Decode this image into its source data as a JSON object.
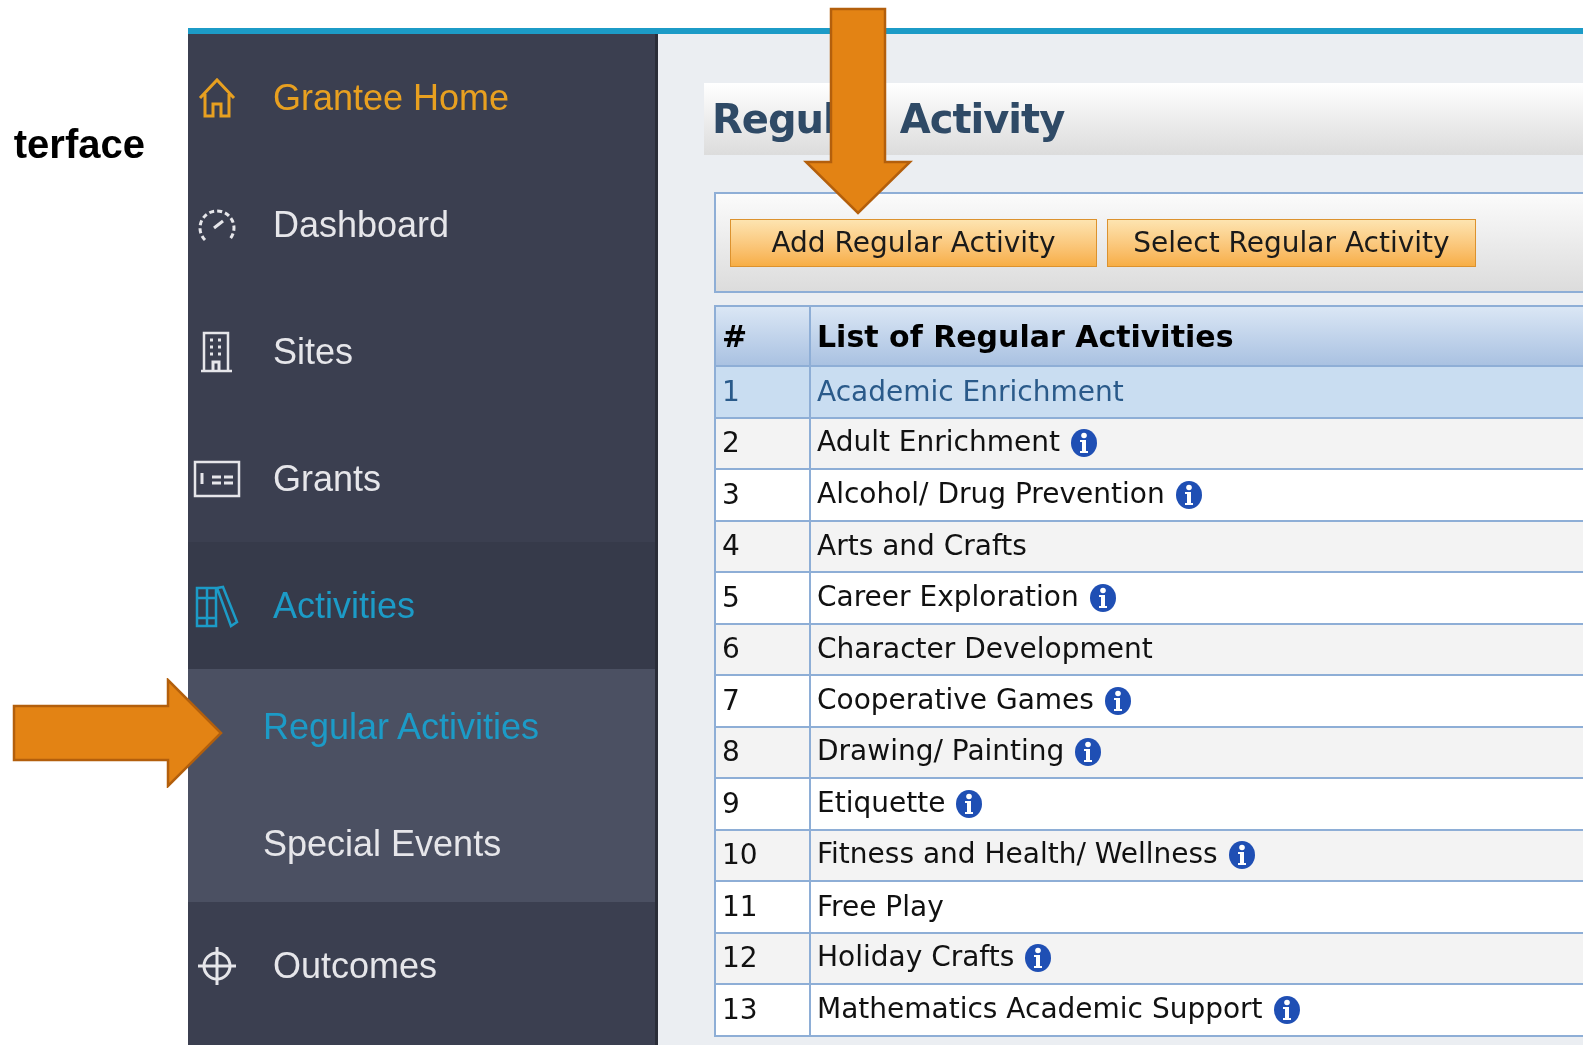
{
  "slide_heading": "terface",
  "sidebar": {
    "items": [
      {
        "label": "Grantee Home",
        "kind": "home",
        "selected": false
      },
      {
        "label": "Dashboard",
        "kind": "dashboard",
        "selected": false
      },
      {
        "label": "Sites",
        "kind": "sites",
        "selected": false
      },
      {
        "label": "Grants",
        "kind": "grants",
        "selected": false
      },
      {
        "label": "Activities",
        "kind": "activities",
        "selected": true,
        "expanded": true,
        "children": [
          {
            "label": "Regular Activities",
            "selected": true
          },
          {
            "label": "Special Events",
            "selected": false
          }
        ]
      },
      {
        "label": "Outcomes",
        "kind": "outcomes",
        "selected": false
      }
    ]
  },
  "page": {
    "title_parts": [
      "Regul",
      "Activity"
    ],
    "buttons": [
      "Add Regular Activity",
      "Select Regular Activity"
    ],
    "table": {
      "columns": [
        "#",
        "List of Regular Activities"
      ],
      "rows": [
        {
          "number": "1",
          "name": "Academic Enrichment",
          "info": false,
          "selected": true
        },
        {
          "number": "2",
          "name": "Adult Enrichment",
          "info": true,
          "selected": false
        },
        {
          "number": "3",
          "name": "Alcohol/ Drug Prevention",
          "info": true,
          "selected": false
        },
        {
          "number": "4",
          "name": "Arts and Crafts",
          "info": false,
          "selected": false
        },
        {
          "number": "5",
          "name": "Career Exploration",
          "info": true,
          "selected": false
        },
        {
          "number": "6",
          "name": "Character Development",
          "info": false,
          "selected": false
        },
        {
          "number": "7",
          "name": "Cooperative Games",
          "info": true,
          "selected": false
        },
        {
          "number": "8",
          "name": "Drawing/ Painting",
          "info": true,
          "selected": false
        },
        {
          "number": "9",
          "name": "Etiquette",
          "info": true,
          "selected": false
        },
        {
          "number": "10",
          "name": "Fitness and Health/ Wellness",
          "info": true,
          "selected": false
        },
        {
          "number": "11",
          "name": "Free Play",
          "info": false,
          "selected": false
        },
        {
          "number": "12",
          "name": "Holiday Crafts",
          "info": true,
          "selected": false
        },
        {
          "number": "13",
          "name": "Mathematics Academic Support",
          "info": true,
          "selected": false
        }
      ]
    }
  },
  "annotations": [
    {
      "kind": "arrow_down"
    },
    {
      "kind": "arrow_right"
    }
  ]
}
